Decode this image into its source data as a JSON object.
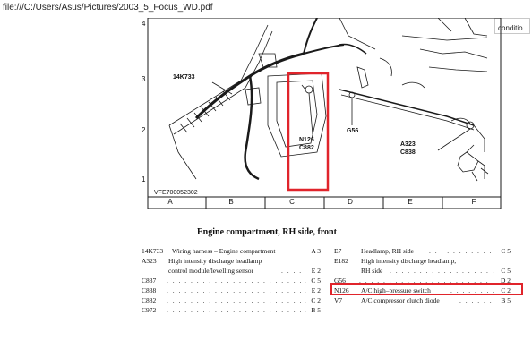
{
  "viewer": {
    "url": "file:///C:/Users/Asus/Pictures/2003_5_Focus_WD.pdf",
    "find_value": "conditio"
  },
  "diagram": {
    "row_numbers": [
      "4",
      "3",
      "2",
      "1"
    ],
    "column_letters": [
      "A",
      "B",
      "C",
      "D",
      "E",
      "F"
    ],
    "callouts": {
      "harness": "14K733",
      "switch": [
        "N126",
        "C882"
      ],
      "ground": "G56",
      "lamp": [
        "A323",
        "C838"
      ]
    },
    "drawing_id": "VFE700052302"
  },
  "page": {
    "title": "Engine compartment, RH side, front"
  },
  "legend_left": [
    {
      "code": "14K733",
      "desc": "Wiring harness – Engine compartment",
      "ref": "A 3"
    },
    {
      "code": "A323",
      "desc": "High intensity discharge headlamp",
      "ref": ""
    },
    {
      "code": "",
      "desc": "control module/levelling sensor",
      "ref": "E 2"
    },
    {
      "code": "C837",
      "desc": "",
      "ref": "C 5"
    },
    {
      "code": "C838",
      "desc": "",
      "ref": "E 2"
    },
    {
      "code": "C882",
      "desc": "",
      "ref": "C 2"
    },
    {
      "code": "C972",
      "desc": "",
      "ref": "B 5"
    }
  ],
  "legend_right": [
    {
      "code": "E7",
      "desc": "Headlamp, RH side",
      "ref": "C 5"
    },
    {
      "code": "E182",
      "desc": "High intensity discharge headlamp,",
      "ref": ""
    },
    {
      "code": "",
      "desc": "RH side",
      "ref": "C 5"
    },
    {
      "code": "G56",
      "desc": "",
      "ref": "D 2"
    },
    {
      "code": "N126",
      "desc": "A/C high–pressure switch",
      "ref": "C 2"
    },
    {
      "code": "V7",
      "desc": "A/C compressor clutch diode",
      "ref": "B 5"
    }
  ],
  "colors": {
    "highlight": "#e0242b",
    "line_art": "#1a1a1a"
  }
}
